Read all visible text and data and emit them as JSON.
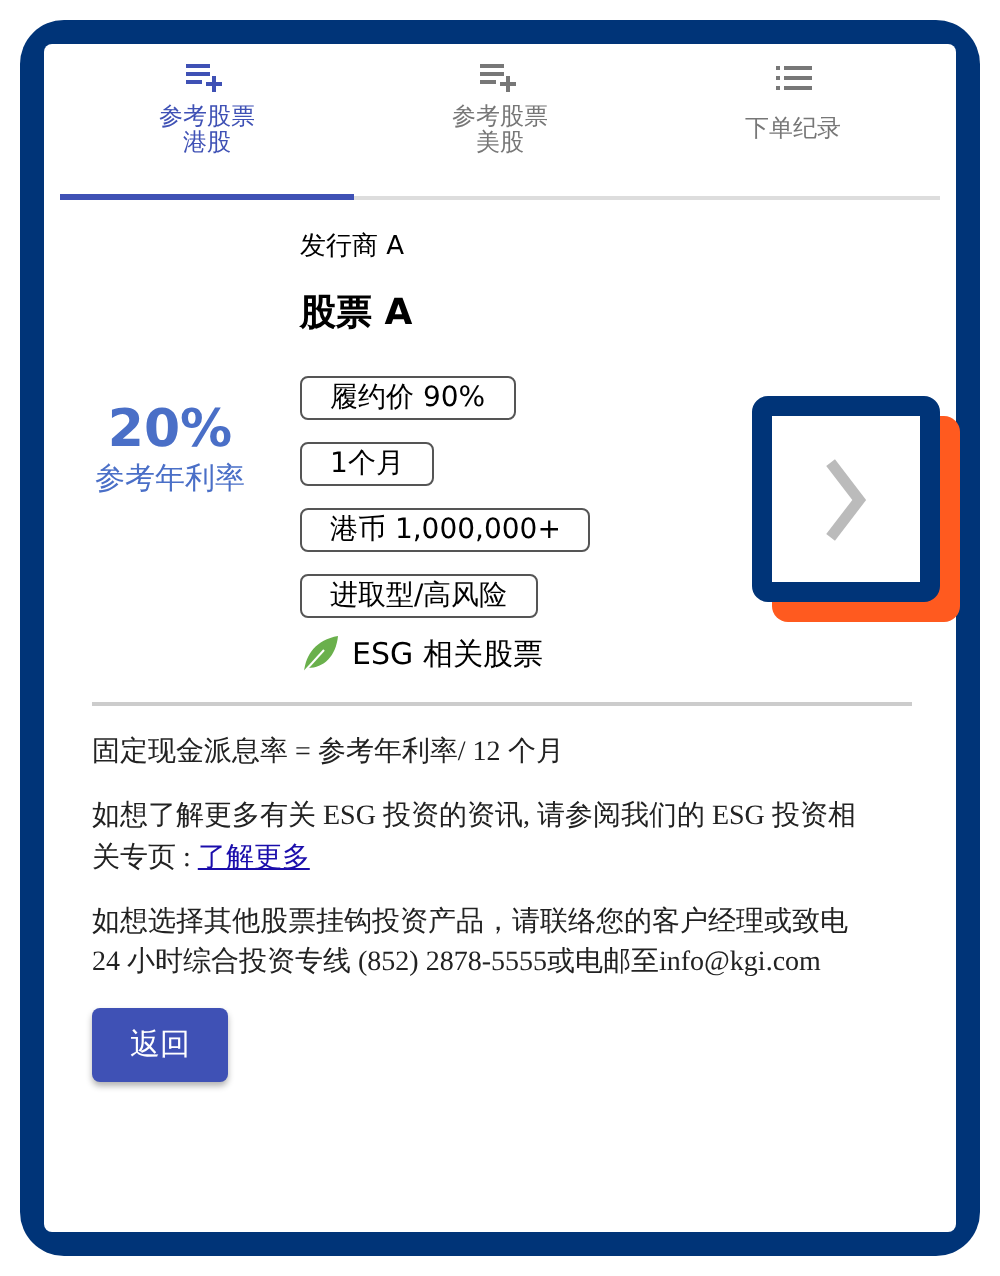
{
  "tabs": [
    {
      "label": "参考股票港股",
      "selected": true
    },
    {
      "label": "参考股票美股",
      "selected": false
    },
    {
      "label": "下单纪录",
      "selected": false
    }
  ],
  "product": {
    "issuer": "发行商 A",
    "name": "股票 A",
    "rate": "20%",
    "rate_label": "参考年利率",
    "tags": [
      "履约价 90%",
      "1个月",
      "港币 1,000,000+",
      "进取型/高风险"
    ],
    "esg_label": "ESG 相关股票"
  },
  "formula": "固定现金派息率 = 参考年利率/ 12 个月",
  "esg_note": {
    "text": "如想了解更多有关 ESG 投资的资讯, 请参阅我们的 ESG 投资相关专页 : ",
    "link": "了解更多"
  },
  "contact": "如想选择其他股票挂钩投资产品，请联络您的客户经理或致电 24 小时综合投资专线 (852) 2878-5555或电邮至info@kgi.com",
  "back_button": "返回"
}
